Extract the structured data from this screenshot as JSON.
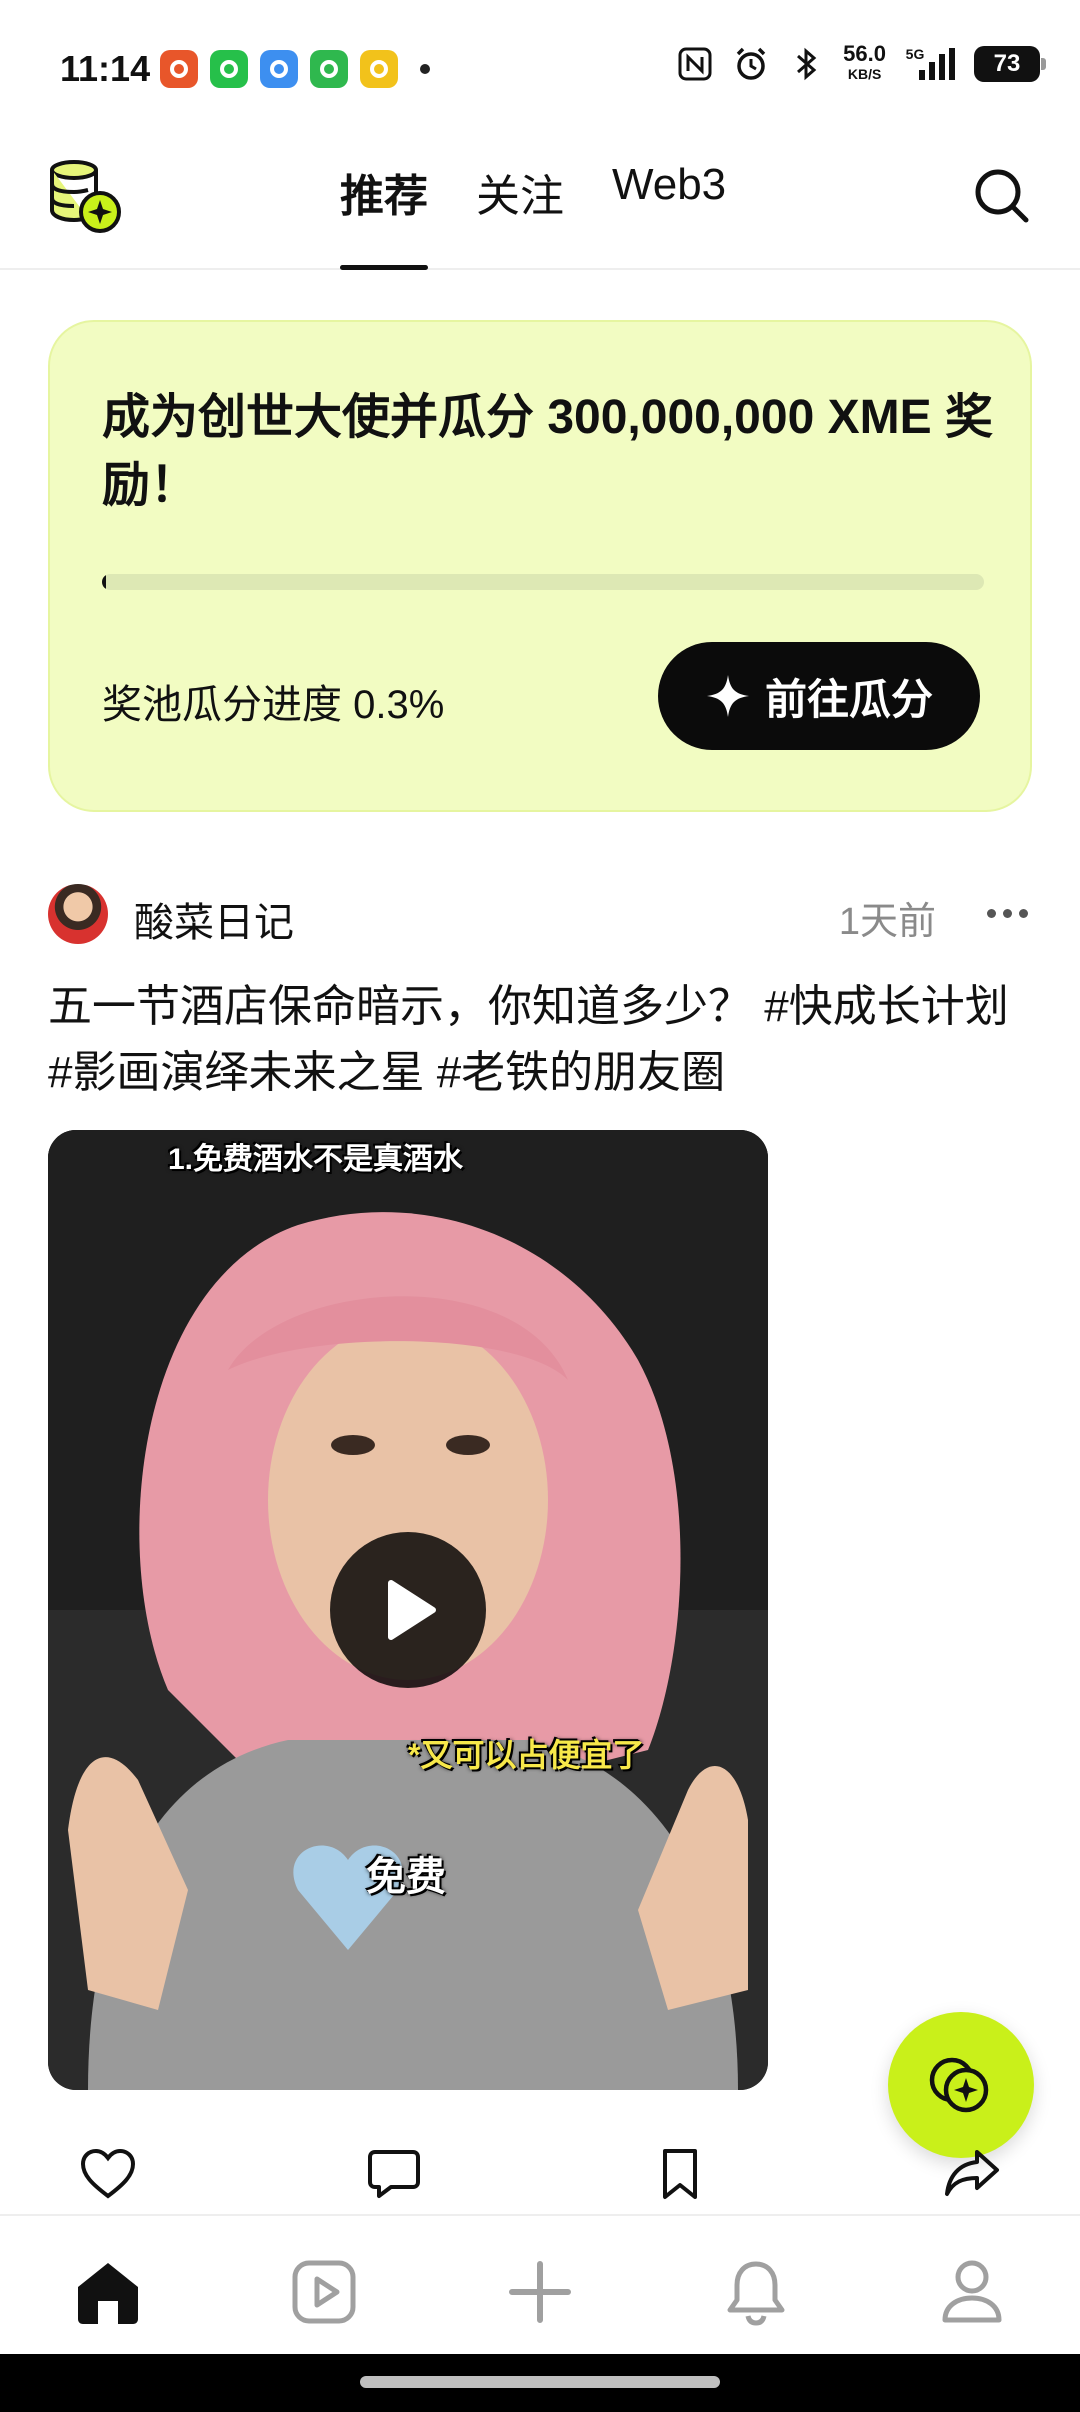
{
  "status_bar": {
    "time": "11:14",
    "network_speed": "56.0",
    "network_unit": "KB/S",
    "network_type": "5G",
    "battery": "73",
    "app_icon_colors": [
      "#e8562a",
      "#26c04a",
      "#3d8ff0",
      "#2fb84e",
      "#f2c21b"
    ]
  },
  "top_nav": {
    "tabs": [
      {
        "label": "推荐",
        "active": true
      },
      {
        "label": "关注",
        "active": false
      },
      {
        "label": "Web3",
        "active": false
      }
    ]
  },
  "reward_card": {
    "title": "成为创世大使并瓜分 300,000,000 XME 奖励！",
    "progress_label": "奖池瓜分进度 0.3%",
    "progress_fraction": 0.003,
    "button_label": "前往瓜分"
  },
  "post": {
    "author": "酸菜日记",
    "time": "1天前",
    "text": "五一节酒店保命暗示，你知道多少？ #快成长计划 #影画演绎未来之星 #老铁的朋友圈",
    "video_captions": {
      "top": "1.免费酒水不是真酒水",
      "middle": "*又可以占便宜了",
      "lower": "免费"
    }
  },
  "colors": {
    "accent_lime": "#c9f01a",
    "card_bg": "#f2fcc2",
    "text": "#111111",
    "muted": "#8a8a8a"
  },
  "icons": {
    "actions": [
      "heart-icon",
      "comment-icon",
      "bookmark-icon",
      "share-icon"
    ],
    "bottom_nav": [
      "home-icon",
      "video-icon",
      "plus-icon",
      "bell-icon",
      "profile-icon"
    ]
  }
}
